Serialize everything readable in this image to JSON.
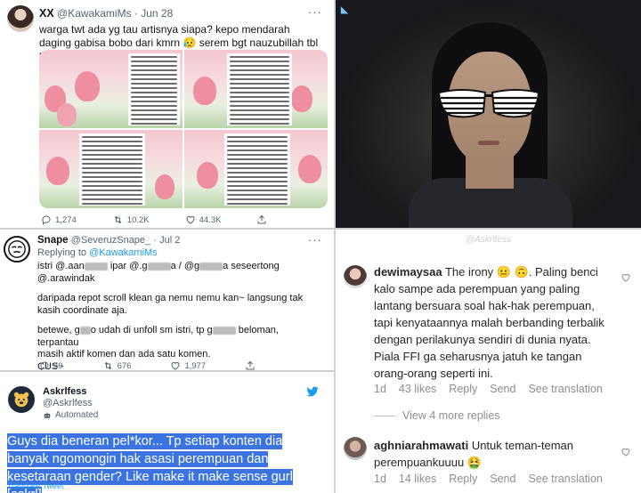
{
  "tweet1": {
    "name": "XX",
    "handle": "@KawakamiMs",
    "date": "· Jun 28",
    "more": "···",
    "text": "warga twt ada yg tau artisnya siapa? kepo mendarah daging gabisa bobo dari kmrn 😥 serem bgt nauzubillah tbl tbl",
    "actions": {
      "replies": "1,274",
      "retweets": "10.2K",
      "likes": "44.3K"
    }
  },
  "tweet2": {
    "name": "Snape",
    "handle": "@SeveruzSnape_",
    "date": "· Jul 2",
    "more": "···",
    "replying_label": "Replying to",
    "replying_to": "@KawakamiMs",
    "lines": {
      "l1a": "istri @.aan",
      "l1b": "ipar @.g",
      "l1c": "a / @g",
      "l1d": "a seseertong",
      "l2": "@.arawindak",
      "l3": "daripada repot scroll klean ga nemu nemu kan~ langsung tak kasih coordinate aja.",
      "l4a": "betewe, g",
      "l4b": "o udah di unfoll sm istri, tp g",
      "l4c": "beloman, terpantau",
      "l5": "masih aktif komen dan ada satu komen.",
      "l6": "CUS~"
    },
    "actions": {
      "replies": "59",
      "retweets": "676",
      "likes": "1,977"
    }
  },
  "tweet3": {
    "name": "Askrlfess",
    "handle": "@Askrlfess",
    "automated": "Automated",
    "more": "···",
    "text": "Guys dia beneran pel*kor... Tp setiap konten dia banyak ngomongin hak asasi perempuan dan kesetaraan gender? Like make it make sense gurl [askrl]",
    "translate": "Translate Tweet"
  },
  "comments": {
    "watermark": "@Askrlfess",
    "c1": {
      "user": "dewimaysaa",
      "text": " The irony 😐 🙃. Paling benci kalo sampe ada perempuan yang paling lantang bersuara soal hak-hak perempuan, tapi kenyataannya malah berbanding terbalik dengan perilakunya sendiri di dunia nyata. Piala FFI ga seharusnya jatuh ke tangan orang-orang seperti ini.",
      "time": "1d",
      "likes": "43 likes",
      "reply": "Reply",
      "send": "Send",
      "translation": "See translation"
    },
    "view_more": "View 4 more replies",
    "c2": {
      "user": "aghniarahmawati",
      "text": " Untuk teman-teman perempuankuuuu 🤮",
      "time": "1d",
      "likes": "14 likes",
      "reply": "Reply",
      "send": "Send",
      "translation": "See translation"
    }
  },
  "colors": {
    "twitter_blue": "#1d9bf0",
    "highlight": "#3b74e0",
    "muted": "#536471",
    "ig_muted": "#8e8e8e"
  }
}
